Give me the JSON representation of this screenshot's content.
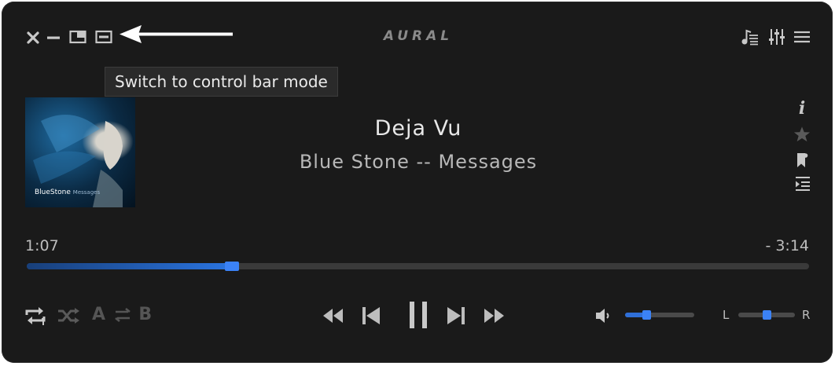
{
  "window": {
    "app_title": "AURAL"
  },
  "tooltip": {
    "text": "Switch to control bar mode"
  },
  "now_playing": {
    "title": "Deja Vu",
    "subtitle": "Blue Stone -- Messages",
    "album_art_label": "BlueStone",
    "album_art_sublabel": "Messages"
  },
  "seek": {
    "elapsed": "1:07",
    "remaining": "- 3:14",
    "progress_fraction": 0.262
  },
  "controls": {
    "ab_loop_a": "A",
    "ab_loop_b": "B"
  },
  "volume": {
    "level_fraction": 0.31
  },
  "balance": {
    "left_label": "L",
    "right_label": "R",
    "position_fraction": 0.5
  },
  "colors": {
    "accent": "#3b82f6",
    "background": "#1a1a1a",
    "icon_active": "#c8c8c8",
    "icon_dim": "#5a5a5a"
  }
}
